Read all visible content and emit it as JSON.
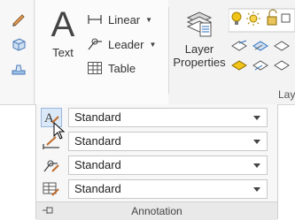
{
  "ribbon": {
    "text_button": {
      "label": "Text"
    },
    "linear_button": {
      "label": "Linear"
    },
    "leader_button": {
      "label": "Leader"
    },
    "table_button": {
      "label": "Table"
    },
    "layer_properties_button": {
      "label_line1": "Layer",
      "label_line2": "Properties"
    },
    "layers_panel_caption": "Lay"
  },
  "annotation_panel": {
    "title": "Annotation",
    "styles": [
      {
        "icon": "text-style-icon",
        "value": "Standard"
      },
      {
        "icon": "dimension-style-icon",
        "value": "Standard"
      },
      {
        "icon": "multileader-style-icon",
        "value": "Standard"
      },
      {
        "icon": "table-style-icon",
        "value": "Standard"
      }
    ]
  },
  "colors": {
    "accent": "#2c6fbd",
    "highlight": "#dbe8f7",
    "bulb": "#f0c419"
  }
}
